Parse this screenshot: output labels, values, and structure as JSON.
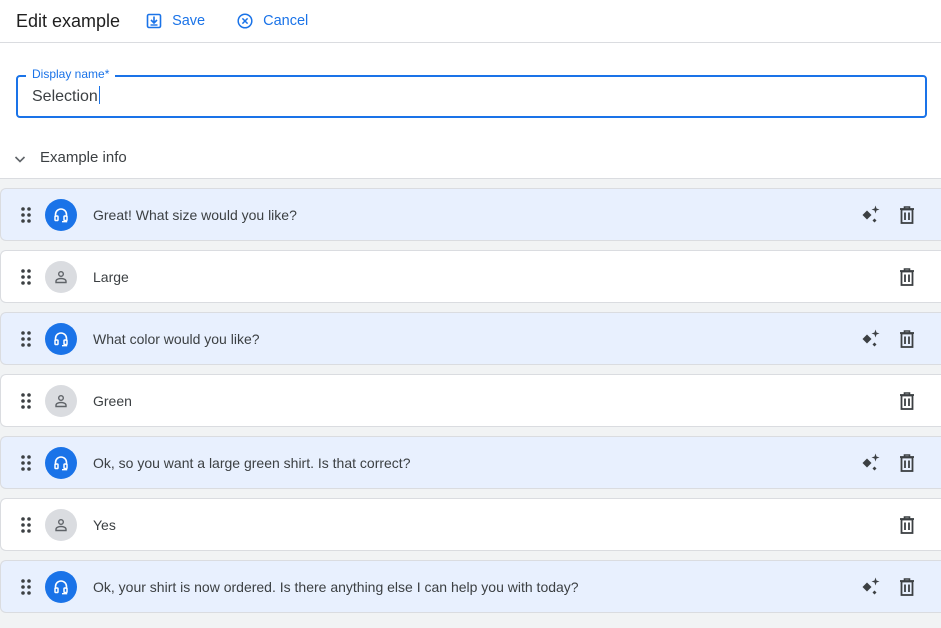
{
  "header": {
    "title": "Edit example",
    "save_label": "Save",
    "cancel_label": "Cancel"
  },
  "display_name": {
    "label": "Display name*",
    "value": "Selection"
  },
  "section": {
    "label": "Example info",
    "expanded": true
  },
  "colors": {
    "accent": "#1a73e8",
    "agent_row_bg": "#e8f0fe",
    "user_avatar_bg": "#dadce0"
  },
  "turns": [
    {
      "role": "agent",
      "text": "Great! What size would you like?",
      "avatar_icon": "headset-icon",
      "actions": [
        "sparkle-icon",
        "delete-icon"
      ]
    },
    {
      "role": "user",
      "text": "Large",
      "avatar_icon": "person-icon",
      "actions": [
        "delete-icon"
      ]
    },
    {
      "role": "agent",
      "text": "What color would you like?",
      "avatar_icon": "headset-icon",
      "actions": [
        "sparkle-icon",
        "delete-icon"
      ]
    },
    {
      "role": "user",
      "text": "Green",
      "avatar_icon": "person-icon",
      "actions": [
        "delete-icon"
      ]
    },
    {
      "role": "agent",
      "text": "Ok, so you want a large green shirt. Is that correct?",
      "avatar_icon": "headset-icon",
      "actions": [
        "sparkle-icon",
        "delete-icon"
      ]
    },
    {
      "role": "user",
      "text": "Yes",
      "avatar_icon": "person-icon",
      "actions": [
        "delete-icon"
      ]
    },
    {
      "role": "agent",
      "text": "Ok, your shirt is now ordered. Is there anything else I can help you with today?",
      "avatar_icon": "headset-icon",
      "actions": [
        "sparkle-icon",
        "delete-icon"
      ]
    }
  ]
}
